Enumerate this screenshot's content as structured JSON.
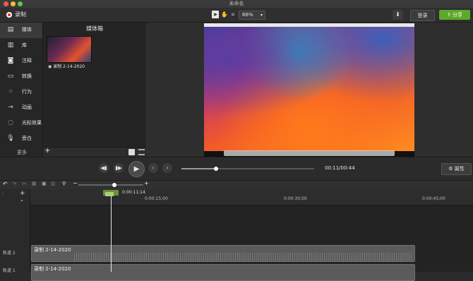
{
  "window": {
    "title": "未命名"
  },
  "toolbar": {
    "record_label": "录制",
    "zoom": "66%",
    "login_label": "登录",
    "share_label": "分享"
  },
  "sidebar": {
    "items": [
      {
        "label": "媒体",
        "icon": "film-icon"
      },
      {
        "label": "库",
        "icon": "library-icon"
      },
      {
        "label": "注释",
        "icon": "annotation-icon"
      },
      {
        "label": "转换",
        "icon": "transition-icon"
      },
      {
        "label": "行为",
        "icon": "behavior-icon"
      },
      {
        "label": "动画",
        "icon": "animation-icon"
      },
      {
        "label": "光标效果",
        "icon": "cursor-effect-icon"
      },
      {
        "label": "旁白",
        "icon": "microphone-icon"
      }
    ],
    "more_label": "更多"
  },
  "media_bin": {
    "title": "媒体箱",
    "clip_label": "录制 2-14-2020"
  },
  "transport": {
    "time": "00:11/00:44",
    "properties_label": "属性",
    "progress": 0.25
  },
  "timeline": {
    "playhead_time": "0:00:11;14",
    "ticks": [
      "0:00:15;00",
      "0:00:30;00",
      "0:00:45;00"
    ],
    "tracks": [
      {
        "label": "轨道 2",
        "clip": "录制 2-14-2020"
      },
      {
        "label": "轨道 1",
        "clip": "录制 2-14-2020"
      }
    ]
  },
  "colors": {
    "accent": "#5ea82a",
    "record": "#e0322c"
  }
}
